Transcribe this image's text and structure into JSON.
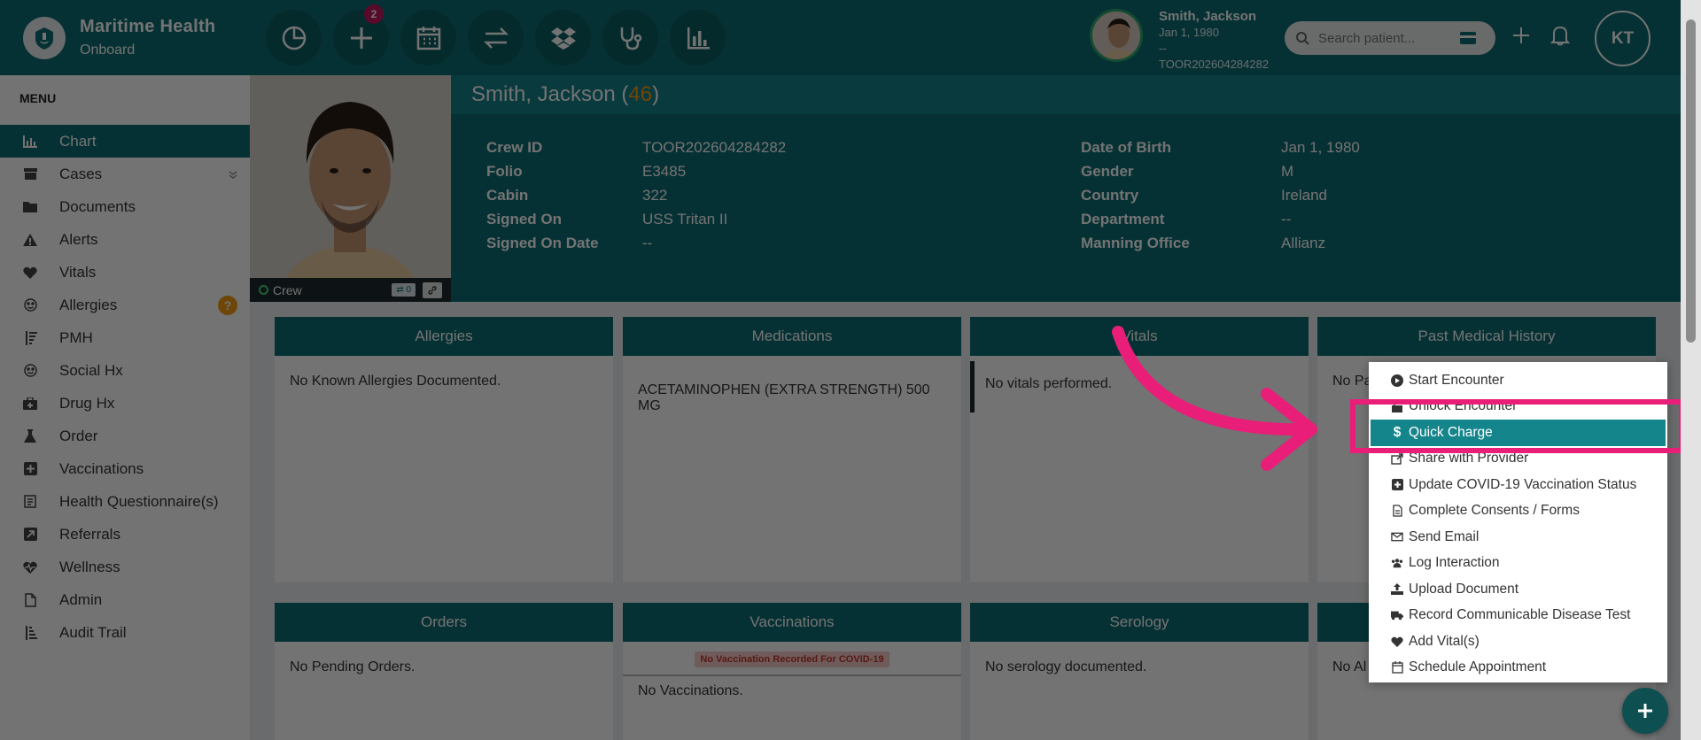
{
  "brand": {
    "title": "Maritime Health",
    "subtitle": "Onboard"
  },
  "toolbar": {
    "items": [
      {
        "icon": "pie-chart-icon"
      },
      {
        "icon": "plus-icon",
        "badge": "2"
      },
      {
        "icon": "calendar-icon"
      },
      {
        "icon": "transfer-icon"
      },
      {
        "icon": "dropbox-icon"
      },
      {
        "icon": "stethoscope-icon"
      },
      {
        "icon": "bar-chart-icon"
      }
    ]
  },
  "patient_mini": {
    "name": "Smith, Jackson",
    "dob": "Jan 1, 1980",
    "dash": "--",
    "id": "TOOR202604284282"
  },
  "search": {
    "placeholder": "Search patient..."
  },
  "user": {
    "initials": "KT"
  },
  "sidebar": {
    "header": "MENU",
    "items": [
      {
        "label": "Chart",
        "icon": "chart-icon",
        "active": true
      },
      {
        "label": "Cases",
        "icon": "cases-icon"
      },
      {
        "label": "Documents",
        "icon": "folder-icon"
      },
      {
        "label": "Alerts",
        "icon": "warning-icon"
      },
      {
        "label": "Vitals",
        "icon": "heart-icon"
      },
      {
        "label": "Allergies",
        "icon": "allergy-icon"
      },
      {
        "label": "PMH",
        "icon": "pmh-icon"
      },
      {
        "label": "Social Hx",
        "icon": "smile-icon"
      },
      {
        "label": "Drug Hx",
        "icon": "medkit-icon"
      },
      {
        "label": "Order",
        "icon": "flask-icon"
      },
      {
        "label": "Vaccinations",
        "icon": "plus-square-icon"
      },
      {
        "label": "Health Questionnaire(s)",
        "icon": "questionnaire-icon"
      },
      {
        "label": "Referrals",
        "icon": "referral-icon"
      },
      {
        "label": "Wellness",
        "icon": "heartbeat-icon"
      },
      {
        "label": "Admin",
        "icon": "file-icon"
      },
      {
        "label": "Audit Trail",
        "icon": "sort-icon"
      }
    ],
    "help_badge": "?"
  },
  "patient": {
    "name": "Smith, Jackson (",
    "age": "46",
    "name_close": ")",
    "status": "Crew",
    "share_count": "0",
    "fields_left": [
      {
        "label": "Crew ID",
        "value": "TOOR202604284282"
      },
      {
        "label": "Folio",
        "value": "E3485"
      },
      {
        "label": "Cabin",
        "value": "322"
      },
      {
        "label": "Signed On",
        "value": "USS Tritan II"
      },
      {
        "label": "Signed On Date",
        "value": "--"
      }
    ],
    "fields_right": [
      {
        "label": "Date of Birth",
        "value": "Jan 1, 1980"
      },
      {
        "label": "Gender",
        "value": "M"
      },
      {
        "label": "Country",
        "value": "Ireland"
      },
      {
        "label": "Department",
        "value": "--"
      },
      {
        "label": "Manning Office",
        "value": "Allianz"
      }
    ]
  },
  "cards": {
    "allergies": {
      "title": "Allergies",
      "body": "No Known Allergies Documented."
    },
    "medications": {
      "title": "Medications",
      "body": "ACETAMINOPHEN (EXTRA STRENGTH) 500 MG"
    },
    "vitals": {
      "title": "Vitals",
      "body": "No vitals performed."
    },
    "pmh": {
      "title": "Past Medical History",
      "body": "No Pa"
    },
    "orders": {
      "title": "Orders",
      "body": "No Pending Orders."
    },
    "vaccinations": {
      "title": "Vaccinations",
      "tag": "No Vaccination Recorded For COVID-19",
      "body": "No Vaccinations."
    },
    "serology": {
      "title": "Serology",
      "body": "No serology documented."
    },
    "fourth2": {
      "title": "",
      "body": "No Al"
    }
  },
  "menu": {
    "items": [
      {
        "label": "Start Encounter",
        "icon": "play-circle-icon"
      },
      {
        "label": "Unlock Encounter",
        "icon": "unlock-icon"
      },
      {
        "label": "Quick Charge",
        "icon": "dollar-icon",
        "highlight": true
      },
      {
        "label": "Share with Provider",
        "icon": "share-icon"
      },
      {
        "label": "Update COVID-19 Vaccination Status",
        "icon": "plus-square-icon"
      },
      {
        "label": "Complete Consents / Forms",
        "icon": "file-text-icon"
      },
      {
        "label": "Send Email",
        "icon": "envelope-icon"
      },
      {
        "label": "Log Interaction",
        "icon": "users-icon"
      },
      {
        "label": "Upload Document",
        "icon": "upload-icon"
      },
      {
        "label": "Record Communicable Disease Test",
        "icon": "ambulance-icon"
      },
      {
        "label": "Add Vital(s)",
        "icon": "heart-icon"
      },
      {
        "label": "Schedule Appointment",
        "icon": "calendar-icon"
      }
    ]
  },
  "colors": {
    "primary": "#0f6e74",
    "accent": "#e91e79",
    "age": "#f39c12"
  }
}
